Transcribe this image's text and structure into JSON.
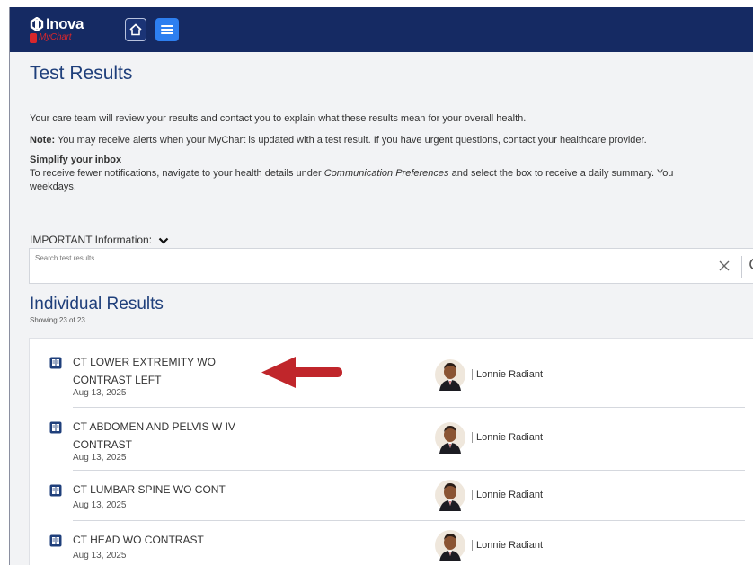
{
  "brand": {
    "name": "Inova",
    "sub": "MyChart"
  },
  "colors": {
    "topbar": "#152a63",
    "accent": "#2d7ff0",
    "title": "#1f3f7b",
    "arrow": "#c0262b"
  },
  "icons": {
    "home": "home-icon",
    "menu": "hamburger-menu-icon",
    "chevron": "chevron-down-icon",
    "clear": "close-icon",
    "search": "search-icon",
    "result": "document-icon",
    "avatar": "avatar-icon"
  },
  "page": {
    "title": "Test Results",
    "intro": "Your care team will review your results and contact you to explain what these results mean for your overall health.",
    "note_label": "Note:",
    "note_text": " You may receive alerts when your MyChart is updated with a test result. If you have urgent questions, contact your healthcare provider.",
    "simplify_title": "Simplify your inbox",
    "simplify_pre": "To receive fewer notifications, navigate to your health details under ",
    "simplify_em": "Communication Preferences",
    "simplify_post": " and select the box to receive a daily summary. You",
    "simplify_line2": "weekdays.",
    "important_label": "IMPORTANT Information:"
  },
  "search": {
    "placeholder": "Search test results"
  },
  "results": {
    "title": "Individual Results",
    "count": "Showing 23 of 23",
    "items": [
      {
        "title": "CT LOWER EXTREMITY WO CONTRAST LEFT",
        "date": "Aug 13, 2025",
        "provider": "Lonnie Radiant"
      },
      {
        "title": "CT ABDOMEN AND PELVIS W IV CONTRAST",
        "date": "Aug 13, 2025",
        "provider": "Lonnie Radiant"
      },
      {
        "title": "CT LUMBAR SPINE WO CONT",
        "date": "Aug 13, 2025",
        "provider": "Lonnie Radiant"
      },
      {
        "title": "CT HEAD WO CONTRAST",
        "date": "Aug 13, 2025",
        "provider": "Lonnie Radiant"
      }
    ]
  }
}
